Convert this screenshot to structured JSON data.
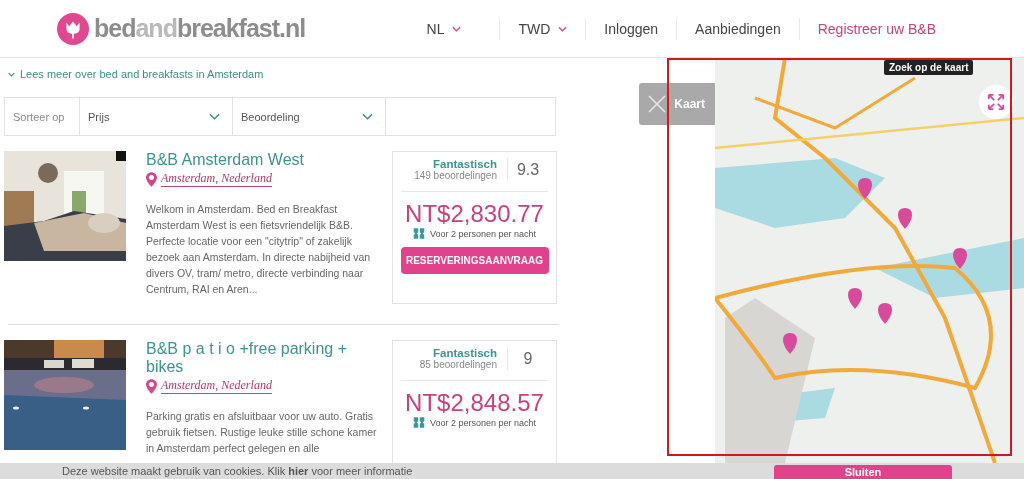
{
  "logo": {
    "parts": [
      {
        "text": "bed",
        "light": false
      },
      {
        "text": "and",
        "light": true
      },
      {
        "text": "breakfast",
        "light": false
      },
      {
        "text": ".nl",
        "light": false
      }
    ]
  },
  "nav": [
    {
      "label": "NL",
      "kind": "dropdown"
    },
    {
      "label": "TWD",
      "kind": "dropdown"
    },
    {
      "label": "Inloggen",
      "kind": "link"
    },
    {
      "label": "Aanbiedingen",
      "kind": "link"
    },
    {
      "label": "Registreer uw B&B",
      "kind": "highlight"
    }
  ],
  "read_more": "Lees meer over bed and breakfasts in Amsterdam",
  "sort": {
    "label": "Sorteer op",
    "options": [
      "Prijs",
      "Beoordeling"
    ]
  },
  "listings": [
    {
      "title": "B&B Amsterdam West",
      "location": "Amsterdam, Nederland",
      "description": "Welkom in Amsterdam. Bed en Breakfast Amsterdam West is een fietsvriendelijk B&B. Perfecte locatie voor een \"citytrip\" of zakelijk bezoek aan Amsterdam. In directe nabijheid van divers OV, tram/ metro, directe verbinding naar Centrum, RAI en Aren...",
      "rating_label": "Fantastisch",
      "reviews": "149 beoordelingen",
      "score": "9.3",
      "price": "NT$2,830.77",
      "price_note": "Voor 2 personen per nacht",
      "button": "RESERVERINGSAANVRAAG"
    },
    {
      "title": "B&B p a t i o +free parking + bikes",
      "location": "Amsterdam, Nederland",
      "description": "Parking gratis en afsluitbaar voor uw auto. Gratis gebruik fietsen. Rustige leuke stille schone kamer in Amsterdam perfect gelegen en alle",
      "rating_label": "Fantastisch",
      "reviews": "85 beoordelingen",
      "score": "9",
      "price": "NT$2,848.57",
      "price_note": "Voor 2 personen per nacht"
    }
  ],
  "map": {
    "toggle": "Kaart",
    "tooltip": "Zoek op de kaart"
  },
  "cookie_bar": {
    "text": "Deze website maakt gebruik van cookies. Klik **hier** voor meer informatie",
    "button": "Sluiten"
  }
}
